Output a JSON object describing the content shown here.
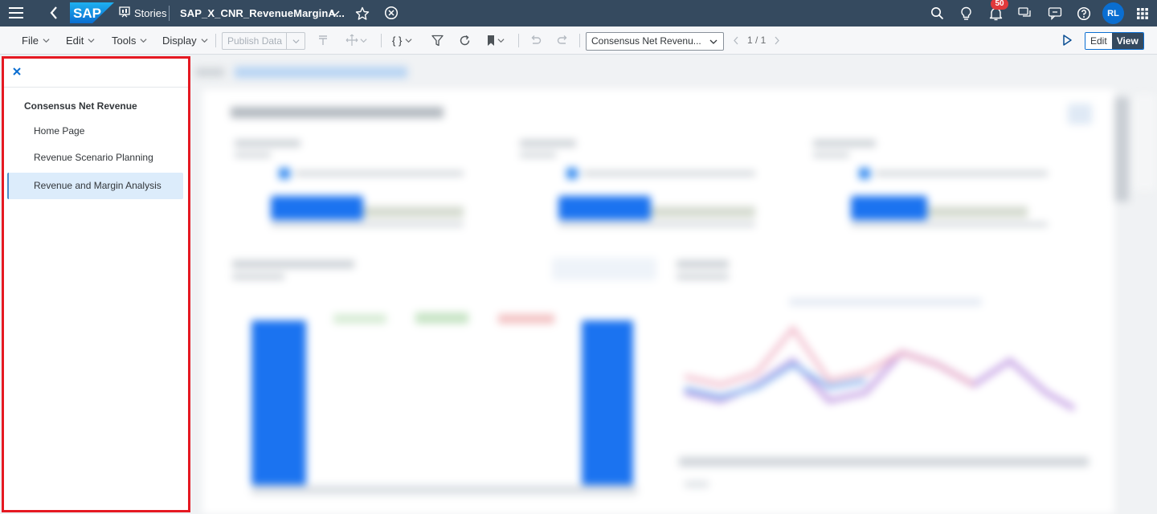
{
  "shell": {
    "logo": "SAP",
    "stories_label": "Stories",
    "story_title": "SAP_X_CNR_RevenueMarginA...",
    "notifications_count": "50",
    "user_initials": "RL"
  },
  "toolbar": {
    "menus": [
      "File",
      "Edit",
      "Tools",
      "Display"
    ],
    "publish_label": "Publish Data",
    "braces_label": "{ }",
    "page_select_value": "Consensus Net Revenu...",
    "pager": "1 / 1",
    "edit_label": "Edit",
    "view_label": "View"
  },
  "nav_panel": {
    "heading": "Consensus Net Revenue",
    "items": [
      {
        "label": "Home Page",
        "active": false
      },
      {
        "label": "Revenue Scenario Planning",
        "active": false
      },
      {
        "label": "Revenue and Margin Analysis",
        "active": true
      }
    ]
  },
  "colors": {
    "shell_bg": "#354a5f",
    "accent": "#0a6ed1",
    "panel_border": "#e51922",
    "active_item_bg": "#dcecfb"
  }
}
